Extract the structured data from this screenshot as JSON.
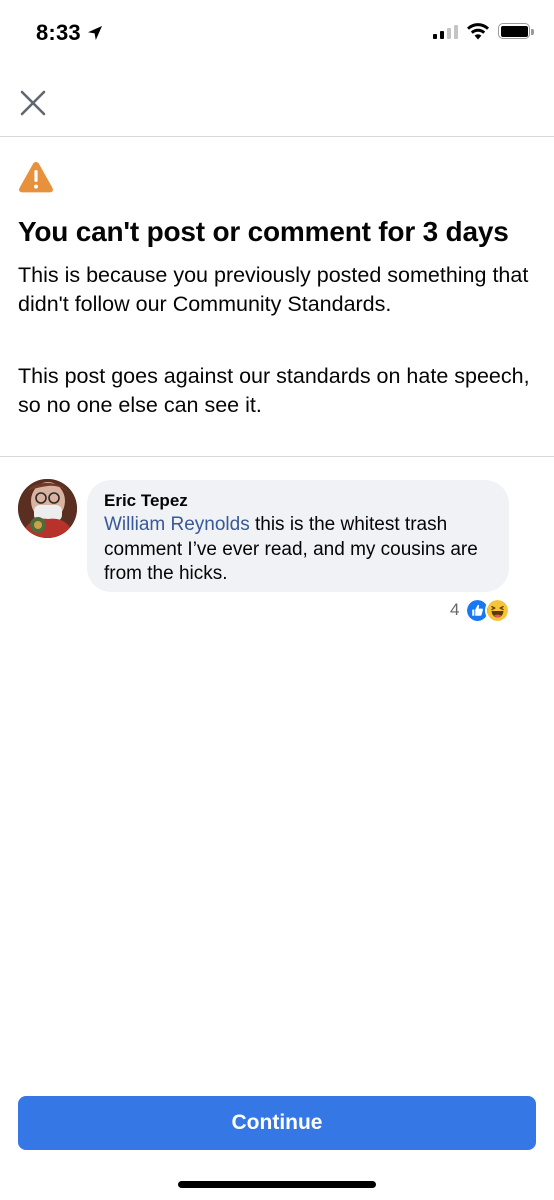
{
  "status_bar": {
    "time": "8:33",
    "icons": [
      "location-arrow-icon",
      "cellular-signal-icon",
      "wifi-icon",
      "battery-icon"
    ]
  },
  "nav": {
    "close_icon": "close-icon"
  },
  "notice": {
    "icon": "warning-icon",
    "icon_color": "#e8913d",
    "title": "You can't post or comment for 3 days",
    "paragraph_1": "This is because you previously posted something that didn't follow our Community Standards.",
    "paragraph_2": "This post goes against our standards on hate speech, so no one else can see it."
  },
  "comment": {
    "author": "Eric Tepez",
    "mention": "William Reynolds",
    "text": " this is the whitest trash comment I’ve ever read, and my cousins are from the hicks.",
    "reaction_count": "4",
    "reactions": [
      "like-icon",
      "haha-icon"
    ],
    "mention_color": "#385898",
    "bubble_color": "#f0f2f5"
  },
  "footer": {
    "continue_label": "Continue",
    "button_color": "#3578e5"
  }
}
